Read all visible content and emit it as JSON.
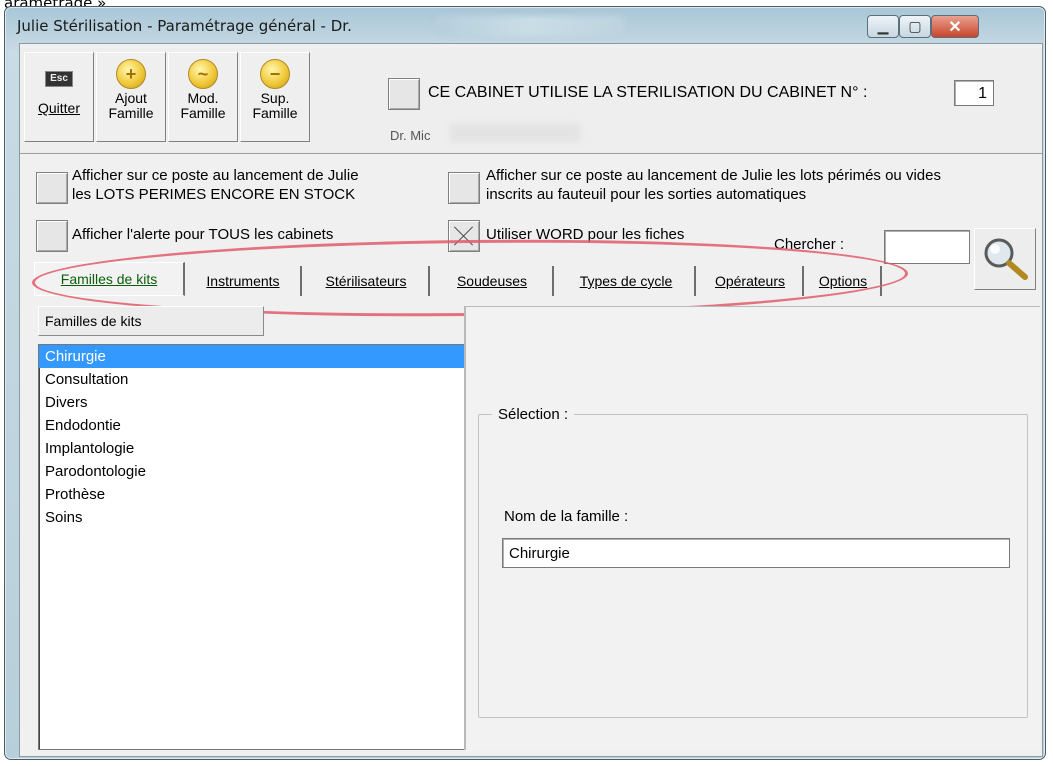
{
  "doc_caption": "aramétrage »",
  "window": {
    "title": "Julie Stérilisation - Paramétrage général - Dr.",
    "minimize_glyph": "▁",
    "maximize_glyph": "▢",
    "close_glyph": "✕"
  },
  "toolbar": {
    "quit": {
      "key": "Esc",
      "label": "Quitter"
    },
    "add": {
      "icon": "plus-icon",
      "glyph": "+",
      "line1": "Ajout",
      "line2": "Famille"
    },
    "mod": {
      "icon": "tilde-icon",
      "glyph": "~",
      "line1": "Mod.",
      "line2": "Famille"
    },
    "sup": {
      "icon": "minus-icon",
      "glyph": "−",
      "line1": "Sup.",
      "line2": "Famille"
    },
    "cabinet_label": "CE CABINET UTILISE LA STERILISATION DU CABINET N° :",
    "cabinet_number": "1",
    "doctor": "Dr. Mic"
  },
  "options": {
    "opt1_line1": "Afficher sur ce poste au lancement de Julie",
    "opt1_line2": "les LOTS PERIMES ENCORE EN STOCK",
    "opt2_line1": "Afficher sur ce poste au lancement de Julie les lots périmés ou vides",
    "opt2_line2": "inscrits au fauteuil pour les sorties automatiques",
    "opt3": "Afficher l'alerte pour TOUS les cabinets",
    "opt4": "Utiliser WORD pour les fiches",
    "opt4_checked": true
  },
  "search": {
    "label": "Chercher :",
    "value": "",
    "icon": "magnifier-icon"
  },
  "tabs": [
    {
      "label": "Familles de kits",
      "active": true
    },
    {
      "label": "Instruments"
    },
    {
      "label": "Stérilisateurs"
    },
    {
      "label": "Soudeuses"
    },
    {
      "label": "Types de cycle"
    },
    {
      "label": "Opérateurs"
    },
    {
      "label": "Options"
    }
  ],
  "families": {
    "header": "Familles de kits",
    "items": [
      "Chirurgie",
      "Consultation",
      "Divers",
      "Endodontie",
      "Implantologie",
      "Parodontologie",
      "Prothèse",
      "Soins"
    ],
    "selected": "Chirurgie"
  },
  "selection": {
    "title": "Sélection :",
    "name_label": "Nom de la famille :",
    "name_value": "Chirurgie"
  },
  "colors": {
    "highlight": "#e05a6a",
    "selected": "#3399ff",
    "active_tab": "#0a5e0a"
  }
}
